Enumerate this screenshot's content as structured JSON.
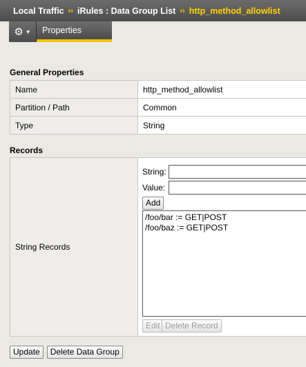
{
  "breadcrumb": {
    "items": [
      "Local Traffic",
      "iRules : Data Group List",
      "http_method_allowlist"
    ],
    "separator": "››"
  },
  "tabs": {
    "gear_icon": "gear-icon",
    "properties": "Properties"
  },
  "general": {
    "title": "General Properties",
    "rows": [
      {
        "label": "Name",
        "value": "http_method_allowlist"
      },
      {
        "label": "Partition / Path",
        "value": "Common"
      },
      {
        "label": "Type",
        "value": "String"
      }
    ]
  },
  "records": {
    "title": "Records",
    "label": "String Records",
    "string_label": "String:",
    "value_label": "Value:",
    "string_value": "",
    "value_value": "",
    "add_label": "Add",
    "items": [
      "/foo/bar := GET|POST",
      "/foo/baz := GET|POST"
    ],
    "edit_label": "Edit",
    "delete_record_label": "Delete Record"
  },
  "footer": {
    "update_label": "Update",
    "delete_group_label": "Delete Data Group"
  },
  "colors": {
    "accent": "#ffd200",
    "tab_underline": "#f2c500",
    "header_bg": "#555555"
  }
}
